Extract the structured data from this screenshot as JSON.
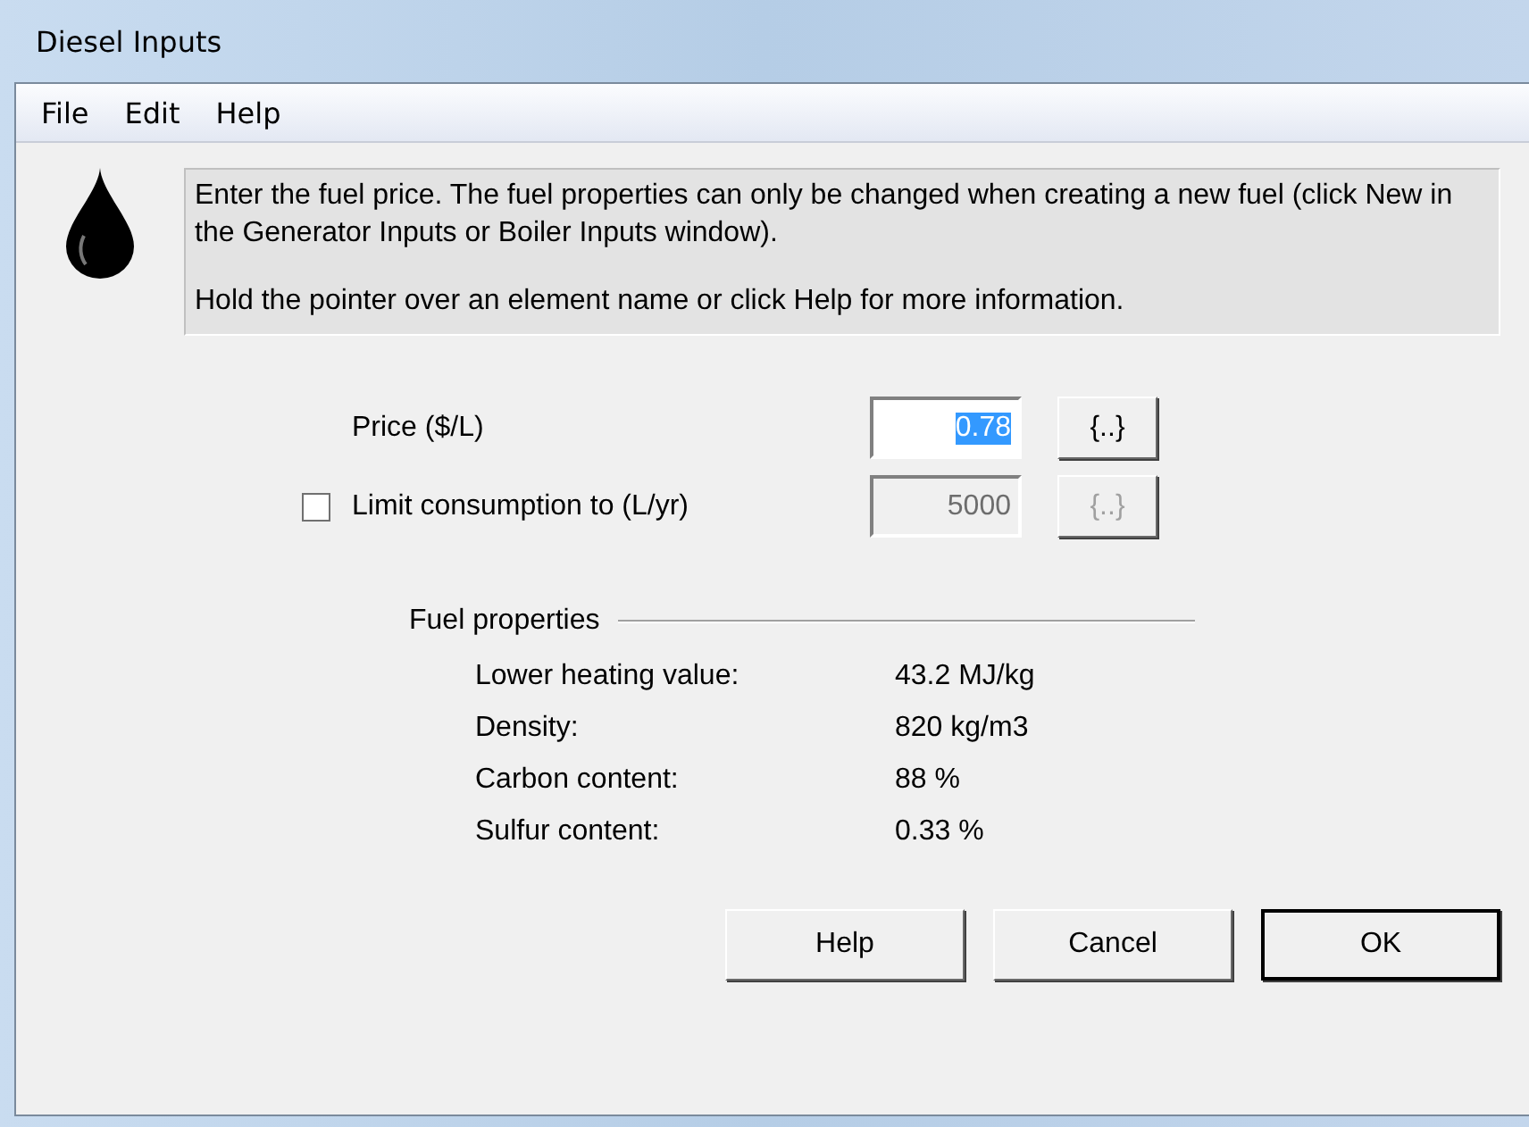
{
  "window": {
    "title": "Diesel Inputs"
  },
  "menu": [
    "File",
    "Edit",
    "Help"
  ],
  "info": [
    "Enter the fuel price. The fuel properties can only be changed when creating a new fuel (click New in the Generator Inputs or Boiler Inputs window).",
    "Hold the pointer over an element name or click Help for more information."
  ],
  "price": {
    "label": "Price  ($/L)",
    "value": "0.78",
    "disabled": false,
    "button": "{..}"
  },
  "limit": {
    "label": "Limit consumption to (L/yr)",
    "checked": false,
    "value": "5000",
    "disabled": true,
    "button": "{..}"
  },
  "fuel_properties": {
    "title": "Fuel properties",
    "rows": [
      {
        "label": "Lower heating value:",
        "value": "43.2 MJ/kg"
      },
      {
        "label": "Density:",
        "value": "820 kg/m3"
      },
      {
        "label": "Carbon content:",
        "value": "88 %"
      },
      {
        "label": "Sulfur content:",
        "value": "0.33 %"
      }
    ]
  },
  "buttons": [
    {
      "label": "Help",
      "default": false
    },
    {
      "label": "Cancel",
      "default": false
    },
    {
      "label": "OK",
      "default": true
    }
  ]
}
